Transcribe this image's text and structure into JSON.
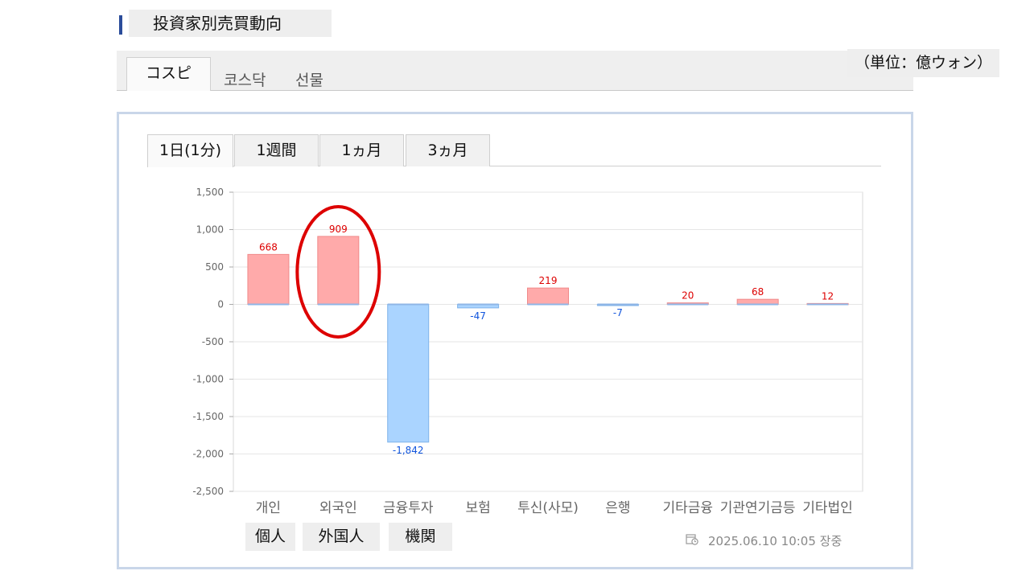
{
  "header": {
    "title": "投資家別売買動向"
  },
  "market_tabs": [
    "コスピ",
    "코스닥",
    "선물"
  ],
  "unit_note": "（単位：億ウォン）",
  "period_tabs": [
    "1日(1分)",
    "1週間",
    "1ヵ月",
    "3ヵ月"
  ],
  "japanese_labels": [
    "個人",
    "外国人",
    "機関"
  ],
  "timestamp": "2025.06.10 10:05 장중",
  "icons": {
    "timestamp": "calendar-clock-icon"
  },
  "colors": {
    "positive_fill": "#ffaaaa",
    "positive_label": "#dd0000",
    "negative_fill": "#aad4ff",
    "negative_label": "#1155dd",
    "highlight_circle": "#dd0000"
  },
  "chart_data": {
    "type": "bar",
    "categories": [
      "개인",
      "외국인",
      "금융투자",
      "보험",
      "투신(사모)",
      "은행",
      "기타금융",
      "기관연기금등",
      "기타법인"
    ],
    "values": [
      668,
      909,
      -1842,
      -47,
      219,
      -7,
      20,
      68,
      12
    ],
    "value_labels": [
      "668",
      "909",
      "-1,842",
      "-47",
      "219",
      "-7",
      "20",
      "68",
      "12"
    ],
    "ylim": [
      -2500,
      1500
    ],
    "yticks": [
      1500,
      1000,
      500,
      0,
      -500,
      -1000,
      -1500,
      -2000,
      -2500
    ],
    "ytick_labels": [
      "1,500",
      "1,000",
      "500",
      "0",
      "-500",
      "-1,000",
      "-1,500",
      "-2,000",
      "-2,500"
    ],
    "grid": true,
    "highlight_category": "외국인"
  }
}
